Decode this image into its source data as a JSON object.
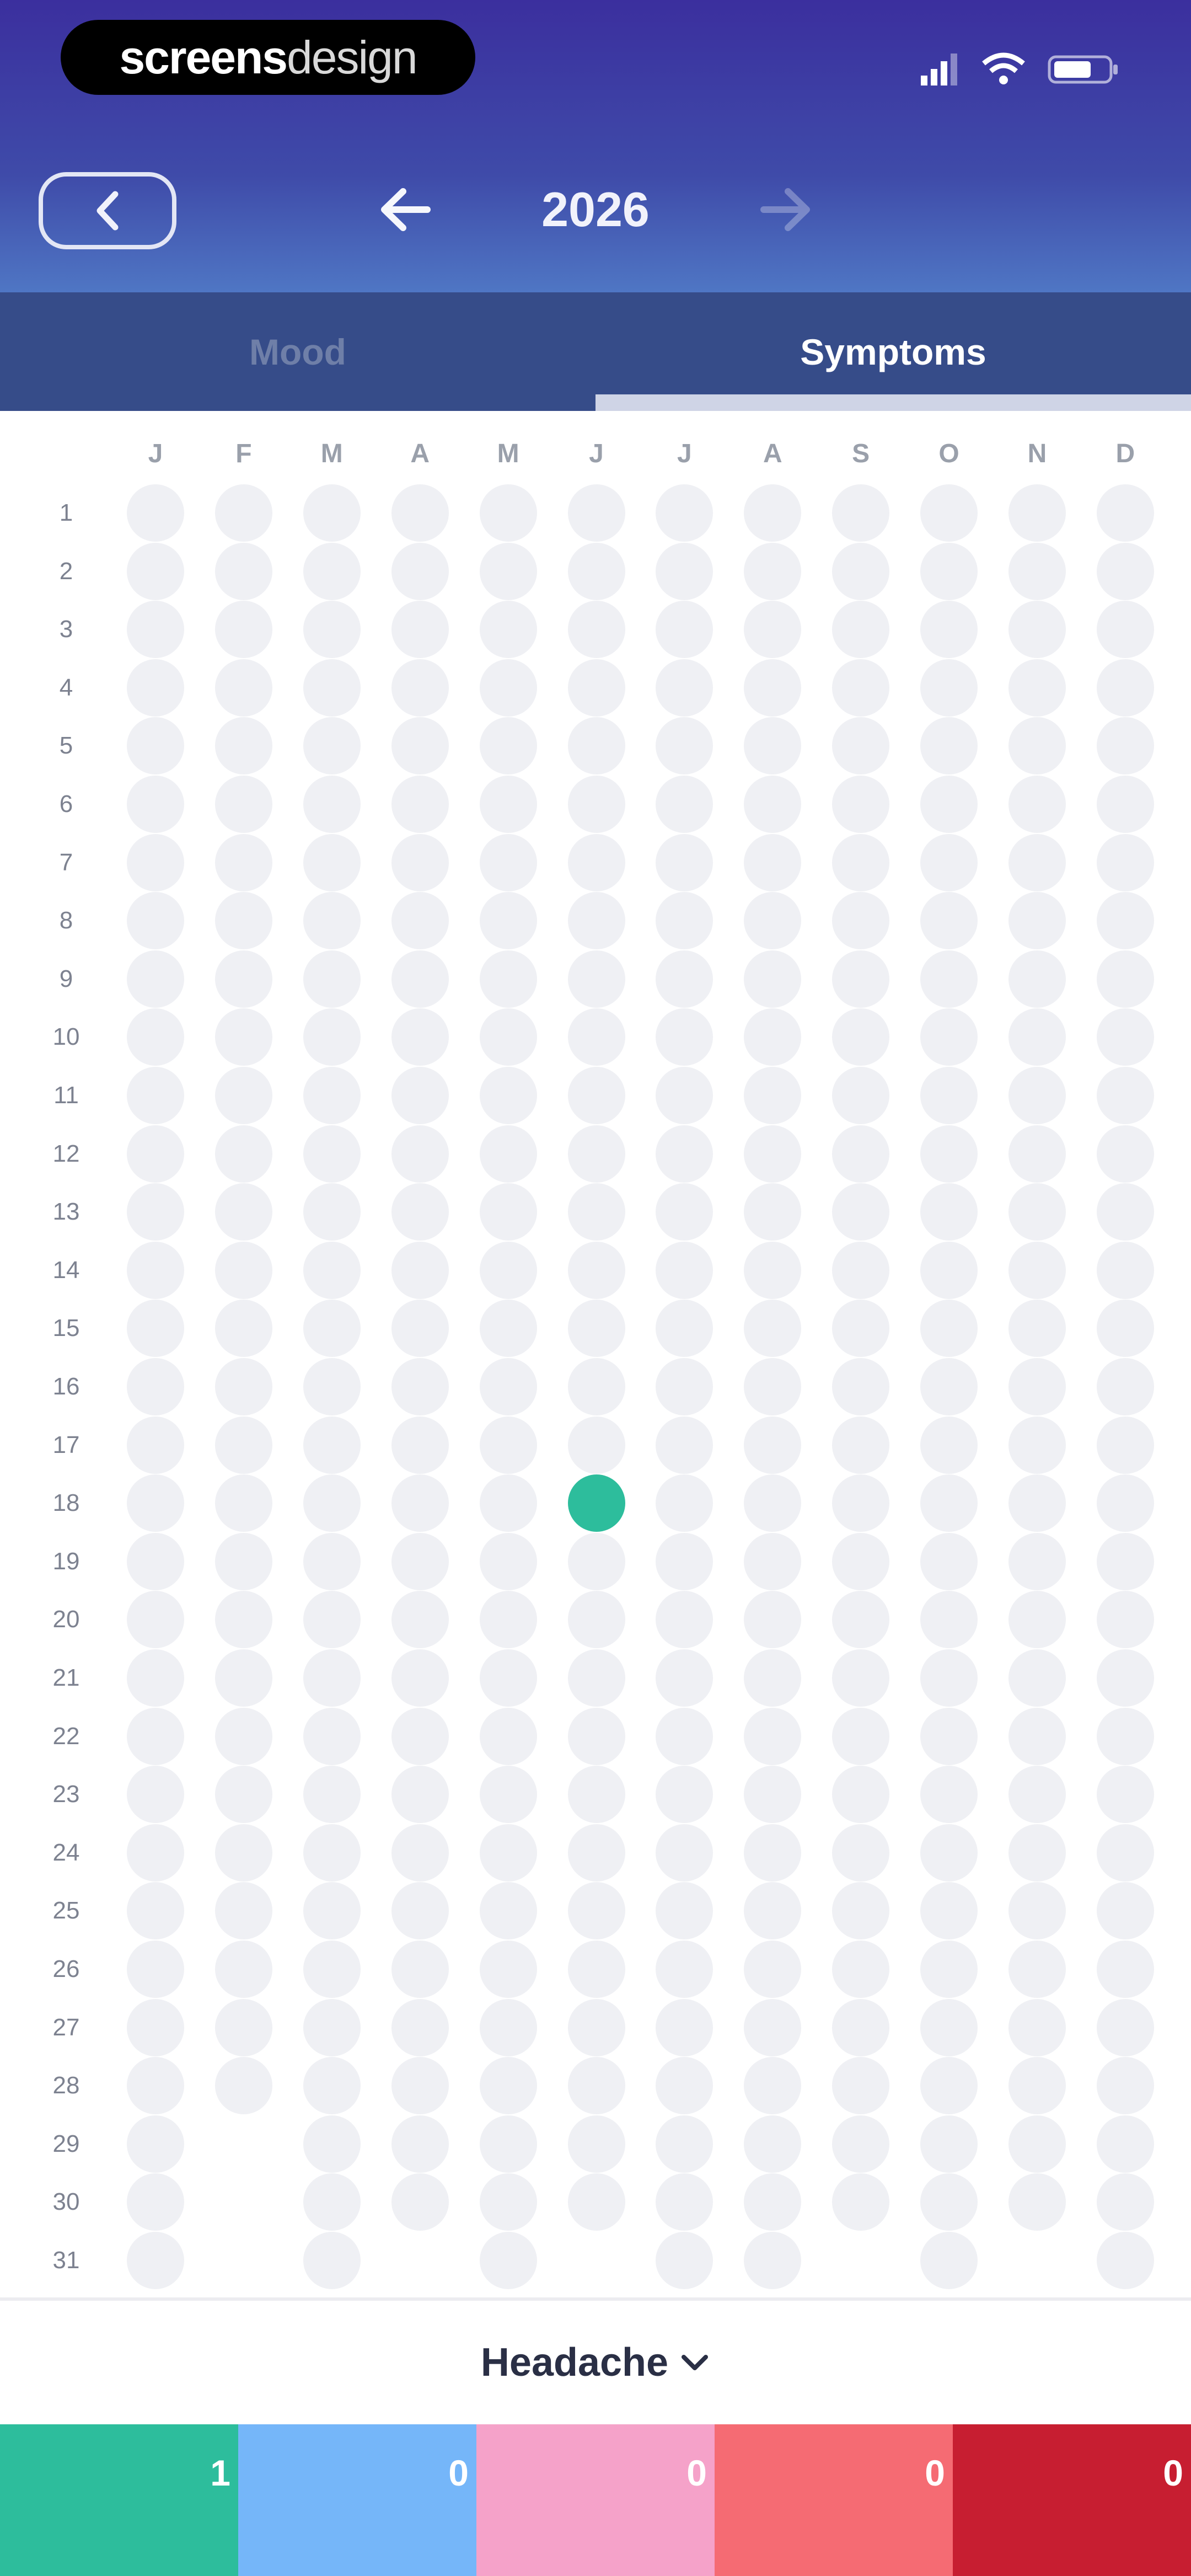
{
  "status_bar": {
    "brand_bold": "screens",
    "brand_light": "design"
  },
  "nav": {
    "year": "2026"
  },
  "tabs": [
    {
      "label": "Mood",
      "active": false
    },
    {
      "label": "Symptoms",
      "active": true
    }
  ],
  "calendar": {
    "months": [
      "J",
      "F",
      "M",
      "A",
      "M",
      "J",
      "J",
      "A",
      "S",
      "O",
      "N",
      "D"
    ],
    "days_in_month": [
      31,
      28,
      31,
      30,
      31,
      30,
      31,
      31,
      30,
      31,
      30,
      31
    ],
    "marked": [
      {
        "month_index": 5,
        "day": 18
      }
    ],
    "marked_color": "#2dbd9c",
    "empty_color": "#eff0f4"
  },
  "symptom_selector": {
    "label": "Headache"
  },
  "legend": [
    {
      "color": "#2dbd9c",
      "count": "1"
    },
    {
      "color": "#75b6f9",
      "count": "0"
    },
    {
      "color": "#f5a2c9",
      "count": "0"
    },
    {
      "color": "#f56b73",
      "count": "0"
    },
    {
      "color": "#c71e31",
      "count": "0"
    }
  ]
}
